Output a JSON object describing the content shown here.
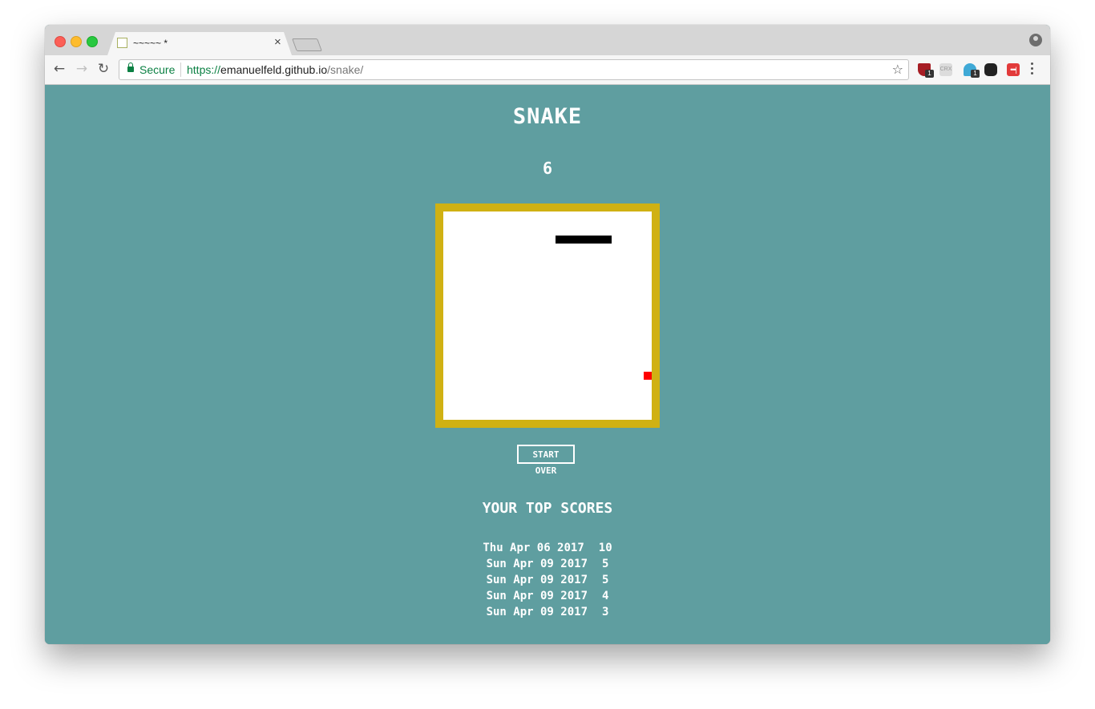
{
  "browser": {
    "tab_title": "~~~~~ *",
    "tab_close": "×",
    "secure_label": "Secure",
    "url_scheme": "https://",
    "url_host": "emanuelfeld.github.io",
    "url_path": "/snake/",
    "ext_crx_label": "CRX",
    "ext_badge_1": "1",
    "ext_badge_3": "1",
    "ext_5_label": "•••|"
  },
  "game": {
    "title": "SNAKE",
    "score": "6",
    "start_over_label": "START OVER",
    "top_scores_title": "YOUR TOP SCORES",
    "top_scores": [
      {
        "date": "Thu Apr 06 2017",
        "score": "10"
      },
      {
        "date": "Sun Apr 09 2017",
        "score": "5"
      },
      {
        "date": "Sun Apr 09 2017",
        "score": "5"
      },
      {
        "date": "Sun Apr 09 2017",
        "score": "4"
      },
      {
        "date": "Sun Apr 09 2017",
        "score": "3"
      }
    ],
    "colors": {
      "background": "#5f9ea0",
      "board_border": "#d0b113",
      "board": "#ffffff",
      "snake": "#000000",
      "food": "#ff0000"
    }
  }
}
